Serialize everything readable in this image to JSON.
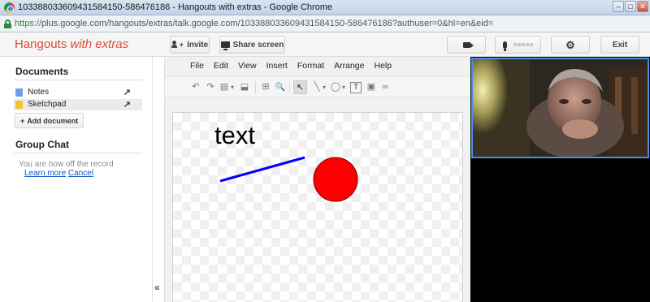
{
  "window": {
    "title": "103388033609431584150-586476186 - Hangouts with extras - Google Chrome",
    "controls": {
      "minimize": "–",
      "maximize": "□",
      "close": "✕"
    }
  },
  "address_bar": {
    "scheme": "https://",
    "rest": "plus.google.com/hangouts/extras/talk.google.com/103388033609431584150-586476186?authuser=0&hl=en&eid="
  },
  "appbar": {
    "title_main": "Hangouts ",
    "title_emph": "with extras",
    "invite_label": "Invite",
    "share_label": "Share screen",
    "exit_label": "Exit",
    "icons": {
      "invite": "add-person-icon",
      "share": "screen-icon",
      "camera": "camera-icon",
      "mic": "microphone-icon",
      "settings": "gear-icon"
    },
    "gear_glyph": "⚙"
  },
  "sidebar": {
    "documents_title": "Documents",
    "documents": [
      {
        "label": "Notes",
        "color": "#6d9eeb",
        "selected": false
      },
      {
        "label": "Sketchpad",
        "color": "#f1c232",
        "selected": true
      }
    ],
    "open_glyph": "↗",
    "add_document": {
      "icon": "+",
      "label": "Add document"
    },
    "group_chat_title": "Group Chat",
    "chat_note": "You are now off the record",
    "learn_more": "Learn more",
    "cancel": "Cancel",
    "collapse_glyph": "«"
  },
  "editor": {
    "menu": [
      "File",
      "Edit",
      "View",
      "Insert",
      "Format",
      "Arrange",
      "Help"
    ],
    "toolbar_icons": [
      "undo-icon",
      "redo-icon",
      "paste-icon",
      "paint-format-icon",
      "fit-icon",
      "zoom-icon",
      "select-icon",
      "line-icon",
      "shape-icon",
      "textbox-icon",
      "image-icon",
      "link-icon"
    ],
    "toolbar_glyphs": {
      "undo": "↶",
      "redo": "↷",
      "paste": "▤",
      "format": "⬓",
      "fit": "⊞",
      "zoom": "🔍",
      "select": "↖",
      "line": "╲",
      "shape": "◯",
      "textbox": "T",
      "image": "▣",
      "link": "∞",
      "dropdown": "▾"
    },
    "drawing": {
      "text": "text",
      "line_color": "#0000ff",
      "circle_color": "#ff0000"
    }
  },
  "colors": {
    "brand": "#dd4b39",
    "link": "#1155cc",
    "video_border": "#4a90e2"
  }
}
